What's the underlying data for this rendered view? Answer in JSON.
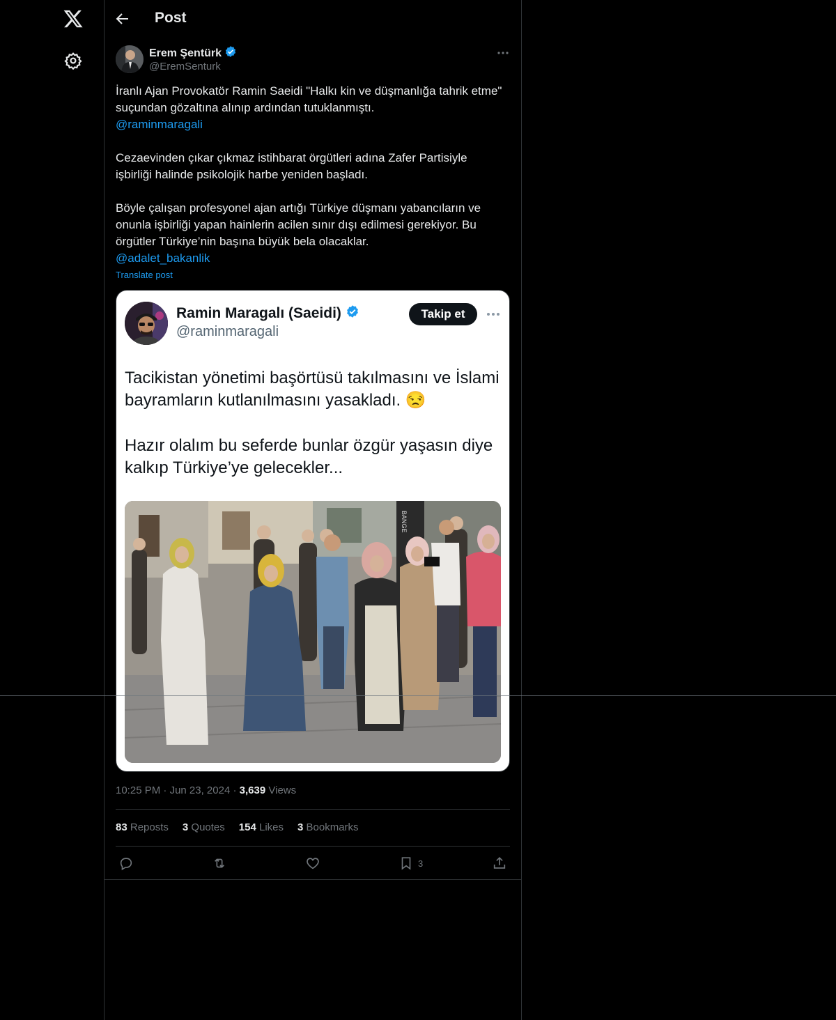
{
  "header": {
    "title": "Post"
  },
  "post": {
    "author": {
      "name": "Erem Şentürk",
      "handle": "@EremSenturk"
    },
    "paragraphs": [
      [
        "İranlı Ajan Provokatör Ramin Saeidi \"Halkı kin ve düşmanlığa tahrik etme\" suçundan gözaltına alınıp ardından tutuklanmıştı.",
        "@raminmaragali"
      ],
      [
        "Cezaevinden çıkar çıkmaz istihbarat örgütleri adına Zafer Partisiyle işbirliği halinde psikolojik harbe yeniden başladı."
      ],
      [
        "Böyle çalışan profesyonel ajan artığı Türkiye düşmanı yabancıların ve onunla işbirliği yapan hainlerin acilen sınır dışı edilmesi gerekiyor. Bu örgütler Türkiye’nin başına büyük bela olacaklar.",
        "@adalet_bakanlik"
      ]
    ],
    "text1": "İranlı Ajan Provokatör Ramin Saeidi \"Halkı kin ve düşmanlığa tahrik etme\" suçundan gözaltına alınıp ardından tutuklanmıştı.",
    "mention1": "@raminmaragali",
    "text2": "Cezaevinden çıkar çıkmaz istihbarat örgütleri adına Zafer Partisiyle işbirliği halinde psikolojik harbe yeniden başladı.",
    "text3": "Böyle çalışan profesyonel ajan artığı Türkiye düşmanı yabancıların ve onunla işbirliği yapan hainlerin acilen sınır dışı edilmesi gerekiyor. Bu örgütler Türkiye’nin başına büyük bela olacaklar.",
    "mention2": "@adalet_bakanlik",
    "translate": "Translate post"
  },
  "embedded": {
    "name": "Ramin Maragalı (Saeidi)",
    "handle": "@raminmaragali",
    "follow": "Takip et",
    "line1": "Tacikistan yönetimi başörtüsü takılmasını ve İslami bayramların kutlanılmasını yasakladı. 😒",
    "line2": "Hazır olalım bu seferde bunlar özgür yaşasın diye kalkıp Türkiye’ye gelecekler...",
    "photo_sign": "BANGE"
  },
  "meta": {
    "time": "10:25 PM",
    "sep": "·",
    "date": "Jun 23, 2024",
    "views_count": "3,639",
    "views_label": "Views"
  },
  "stats": {
    "reposts": {
      "count": "83",
      "label": "Reposts"
    },
    "quotes": {
      "count": "3",
      "label": "Quotes"
    },
    "likes": {
      "count": "154",
      "label": "Likes"
    },
    "bookmarks": {
      "count": "3",
      "label": "Bookmarks"
    }
  },
  "actions": {
    "bookmark_count": "3"
  },
  "colors": {
    "background": "#000000",
    "text": "#e7e9ea",
    "muted": "#71767b",
    "accent": "#1d9bf0",
    "border": "#2f3336"
  },
  "icons": [
    "x-logo-icon",
    "gear-icon",
    "back-arrow-icon",
    "verified-icon",
    "more-icon",
    "reply-icon",
    "repost-icon",
    "like-icon",
    "bookmark-icon",
    "share-icon"
  ]
}
